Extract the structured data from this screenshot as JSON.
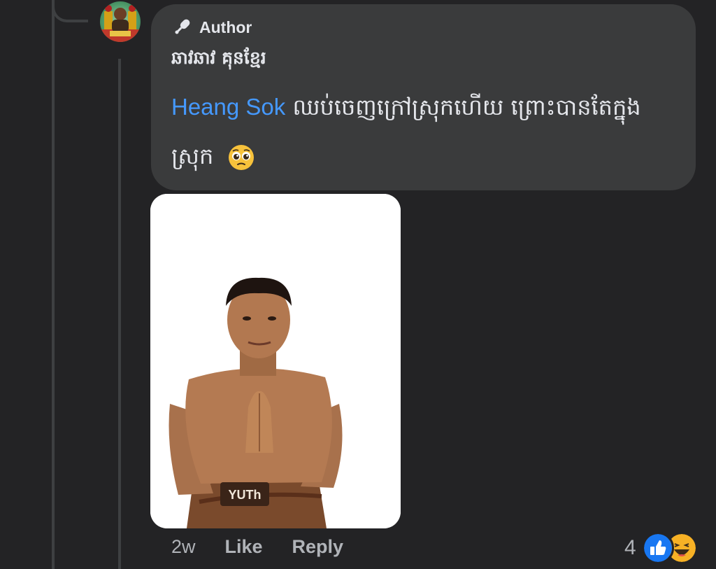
{
  "comment": {
    "author_badge": "Author",
    "author_badge_icon": "microphone-icon",
    "commenter_name": "ឆាវឆាវ គុនខ្មែរ",
    "mention": "Heang Sok",
    "body_text": " ឈប់ចេញក្រៅស្រុកហើយ ព្រោះបានតែក្នុងស្រុក",
    "emoji": "pleading-face-emoji"
  },
  "photo": {
    "subject": "fighter-photo",
    "shorts_logo": "YUTh"
  },
  "actions": {
    "timestamp": "2w",
    "like_label": "Like",
    "reply_label": "Reply"
  },
  "reactions": {
    "count": "4",
    "icons": [
      "like-reaction-icon",
      "haha-reaction-icon"
    ]
  },
  "colors": {
    "background": "#232325",
    "bubble": "#3a3b3c",
    "mention": "#4599ff",
    "text": "#e4e6eb",
    "muted": "#b0b3b8"
  }
}
